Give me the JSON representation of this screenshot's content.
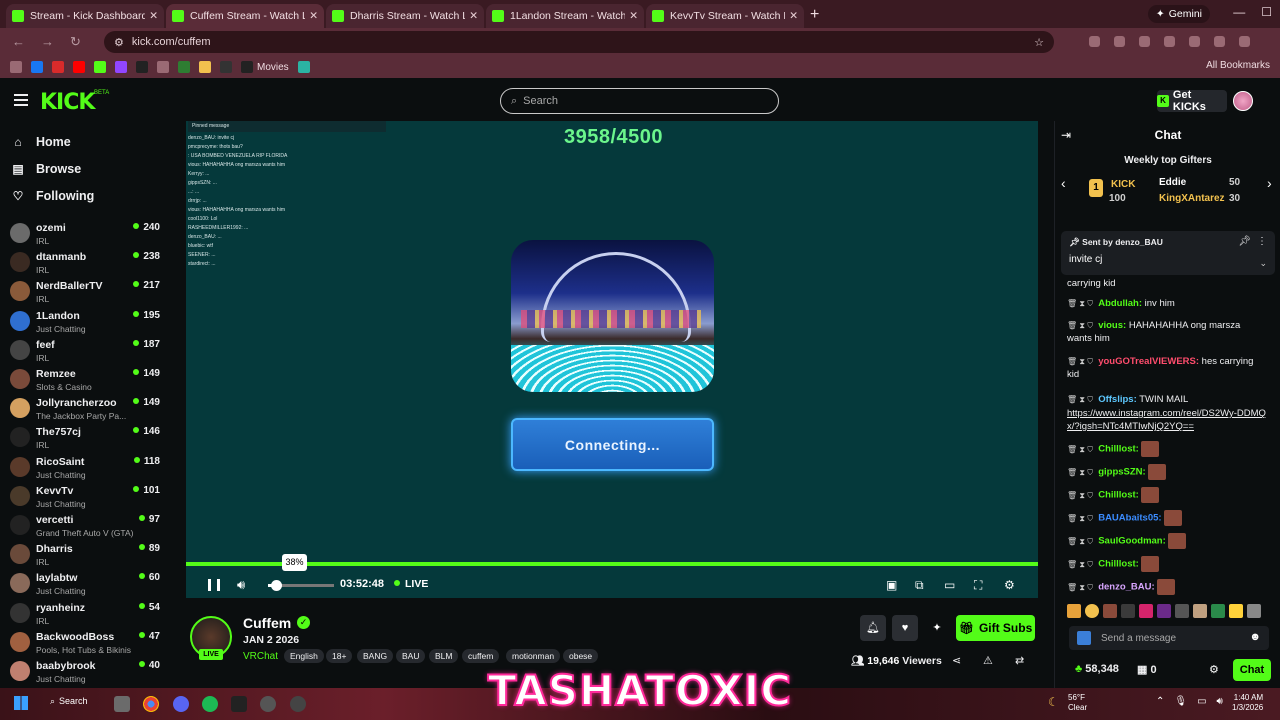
{
  "browser": {
    "tabs": [
      {
        "label": "Stream - Kick Dashboard",
        "active": false
      },
      {
        "label": "Cuffem Stream - Watch Live",
        "active": true
      },
      {
        "label": "Dharris Stream - Watch Live on",
        "active": false
      },
      {
        "label": "1Landon Stream - Watch Live o",
        "active": false
      },
      {
        "label": "KevvTv Stream - Watch Live on",
        "active": false
      }
    ],
    "new_tab": "+",
    "gemini": "Gemini",
    "url": "kick.com/cuffem",
    "bookmarks_movies": "Movies",
    "all_bookmarks": "All Bookmarks"
  },
  "header": {
    "logo": "KICK",
    "beta": "BETA",
    "search_placeholder": "Search",
    "get_kicks": "Get KICKs"
  },
  "sidebar": {
    "nav": [
      {
        "label": "Home",
        "icon": "home-icon"
      },
      {
        "label": "Browse",
        "icon": "browse-icon"
      },
      {
        "label": "Following",
        "icon": "heart-icon"
      }
    ],
    "channels": [
      {
        "name": "ozemi",
        "category": "IRL",
        "viewers": "240"
      },
      {
        "name": "dtanmanb",
        "category": "IRL",
        "viewers": "238"
      },
      {
        "name": "NerdBallerTV",
        "category": "IRL",
        "viewers": "217"
      },
      {
        "name": "1Landon",
        "category": "Just Chatting",
        "viewers": "195"
      },
      {
        "name": "feef",
        "category": "IRL",
        "viewers": "187"
      },
      {
        "name": "Remzee",
        "category": "Slots & Casino",
        "viewers": "149"
      },
      {
        "name": "Jollyrancherzoo",
        "category": "The Jackbox Party Pa...",
        "viewers": "149"
      },
      {
        "name": "The757cj",
        "category": "IRL",
        "viewers": "146"
      },
      {
        "name": "RicoSaint",
        "category": "Just Chatting",
        "viewers": "118"
      },
      {
        "name": "KevvTv",
        "category": "Just Chatting",
        "viewers": "101"
      },
      {
        "name": "vercetti",
        "category": "Grand Theft Auto V (GTA)",
        "viewers": "97"
      },
      {
        "name": "Dharris",
        "category": "IRL",
        "viewers": "89"
      },
      {
        "name": "laylabtw",
        "category": "Just Chatting",
        "viewers": "60"
      },
      {
        "name": "ryanheinz",
        "category": "IRL",
        "viewers": "54"
      },
      {
        "name": "BackwoodBoss",
        "category": "Pools, Hot Tubs & Bikinis",
        "viewers": "47"
      },
      {
        "name": "baabybrook",
        "category": "Just Chatting",
        "viewers": "40"
      }
    ]
  },
  "player": {
    "overlay_chat": [
      "Pinned message",
      "denzo_BAU: invite cj",
      "pmcprecyme: thots bau?",
      ": USA BOMBED VENEZUELA RIP FLORIDA",
      "vious: HAHAHAHHA ong marsza wants him",
      "Kerryy: ...",
      "gippsSZN: ...",
      "...: ...",
      "drrrjp: ...",
      "vious: HAHAHAHHA ong marsza wants him",
      "cool1100: Lol",
      "RASHEEDMILLER1992: ...",
      "denzo_BAU: ...",
      "bluebic: wtf",
      "SEENER: ...",
      "stardirect: ..."
    ],
    "counter": "3958/4500",
    "connecting": "Connecting...",
    "volume_tooltip": "38%",
    "volume_level": 0.38,
    "time": "03:52:48",
    "live": "LIVE"
  },
  "stream": {
    "streamer": "Cuffem",
    "live_badge": "LIVE",
    "title": "JAN 2 2026",
    "category": "VRChat",
    "tags": [
      "English",
      "18+",
      "BANG",
      "BAU",
      "BLM",
      "cuffem",
      "motionman",
      "obese"
    ],
    "gift_subs": "Gift Subs",
    "viewers": "19,646",
    "viewers_label": "Viewers"
  },
  "chat": {
    "title": "Chat",
    "gifters_title": "Weekly top Gifters",
    "gifters": [
      {
        "name": "KICK",
        "amount": "100"
      },
      {
        "name": "Eddie",
        "amount": "50"
      },
      {
        "name": "KingXAntarez",
        "amount": "30"
      }
    ],
    "pinned_by": "Sent by",
    "pinned_user": "denzo_BAU",
    "pinned_message": "invite cj",
    "messages": [
      {
        "user": "",
        "text": "carrying kid",
        "color": "#efeff1"
      },
      {
        "user": "Abdullah:",
        "text": "inv him",
        "color": "#53fc18"
      },
      {
        "user": "vious:",
        "text": "HAHAHAHHA ong marsza wants him",
        "color": "#53fc18"
      },
      {
        "user": "youGOTrealVIEWERS:",
        "text": "hes carrying kid",
        "color": "#ff4d6d"
      },
      {
        "user": "Offslips:",
        "text": "TWIN MAIL",
        "color": "#5ec8ff"
      },
      {
        "user": "",
        "text": "https://www.instagram.com/reel/DS2Wy-DDMQx/?igsh=NTc4MTIwNjQ2YQ==",
        "color": "#efeff1"
      },
      {
        "user": "Chilllost:",
        "text": "",
        "color": "#53fc18"
      },
      {
        "user": "gippsSZN:",
        "text": "",
        "color": "#53fc18"
      },
      {
        "user": "Chilllost:",
        "text": "",
        "color": "#53fc18"
      },
      {
        "user": "BAUAbaits05:",
        "text": "",
        "color": "#3b8cff"
      },
      {
        "user": "SaulGoodman:",
        "text": "",
        "color": "#53fc18"
      },
      {
        "user": "Chilllost:",
        "text": "",
        "color": "#53fc18"
      },
      {
        "user": "denzo_BAU:",
        "text": "",
        "color": "#d9a6ff"
      }
    ],
    "send_placeholder": "Send a message",
    "points": "58,348",
    "second_count": "0",
    "chat_button": "Chat"
  },
  "overlay_text": "TASHATOXIC",
  "taskbar": {
    "search": "Search",
    "temp": "56°F",
    "weather": "Clear",
    "time": "1:40 AM",
    "date": "1/3/2026"
  },
  "colors": {
    "kick_green": "#53fc18",
    "player_bg": "#05393b",
    "page_bg": "#0b0e0f"
  }
}
